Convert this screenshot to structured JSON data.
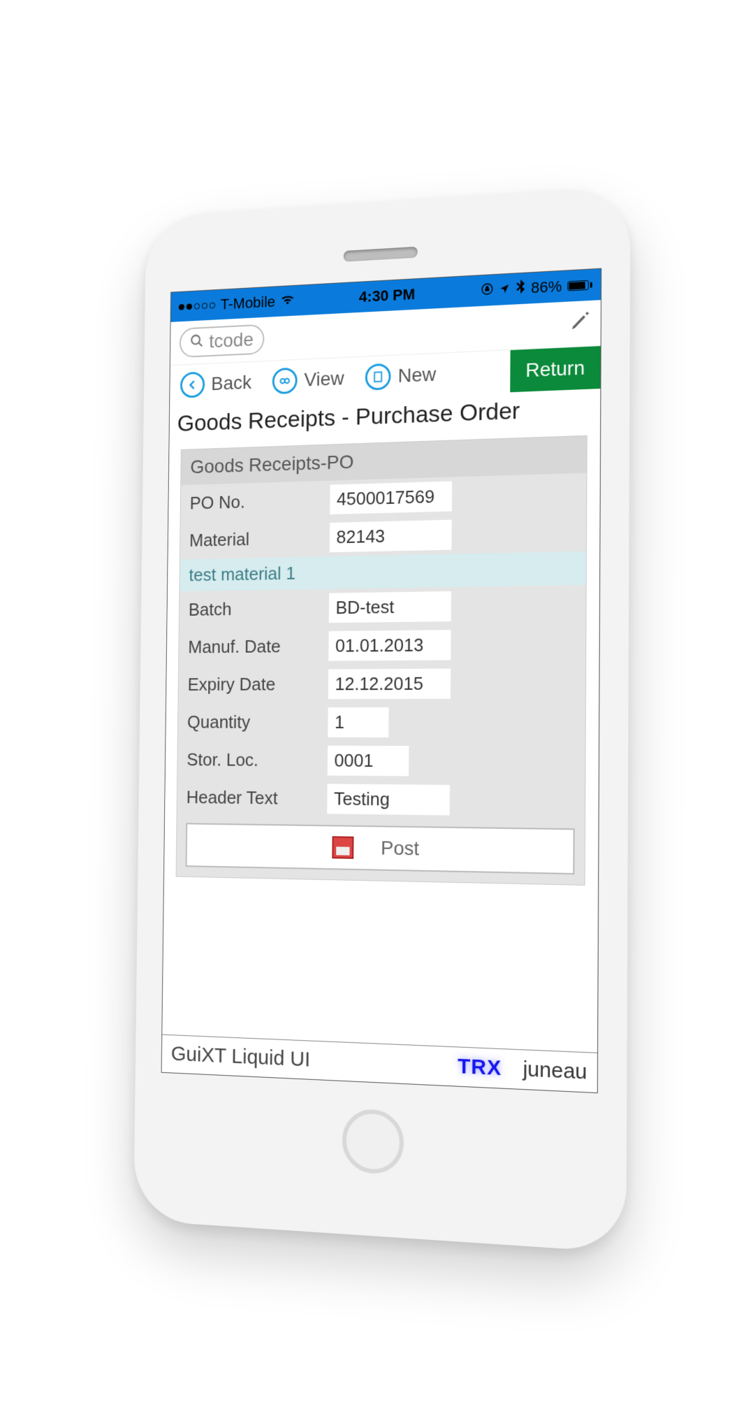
{
  "status": {
    "carrier": "T-Mobile",
    "time": "4:30 PM",
    "battery_pct": "86%"
  },
  "search": {
    "placeholder": "tcode"
  },
  "toolbar": {
    "back": "Back",
    "view": "View",
    "new": "New",
    "return": "Return"
  },
  "page_title": "Goods Receipts - Purchase Order",
  "panel": {
    "header": "Goods Receipts-PO",
    "fields": {
      "po_no": {
        "label": "PO No.",
        "value": "4500017569"
      },
      "material": {
        "label": "Material",
        "value": "82143"
      },
      "material_desc": "test material 1",
      "batch": {
        "label": "Batch",
        "value": "BD-test"
      },
      "manuf_date": {
        "label": "Manuf. Date",
        "value": "01.01.2013"
      },
      "expiry_date": {
        "label": "Expiry Date",
        "value": "12.12.2015"
      },
      "quantity": {
        "label": "Quantity",
        "value": "1"
      },
      "stor_loc": {
        "label": "Stor. Loc.",
        "value": "0001"
      },
      "header_text": {
        "label": "Header Text",
        "value": "Testing"
      }
    },
    "post_label": "Post"
  },
  "footer": {
    "app_name": "GuiXT Liquid UI",
    "trx": "TRX",
    "server": "juneau"
  }
}
